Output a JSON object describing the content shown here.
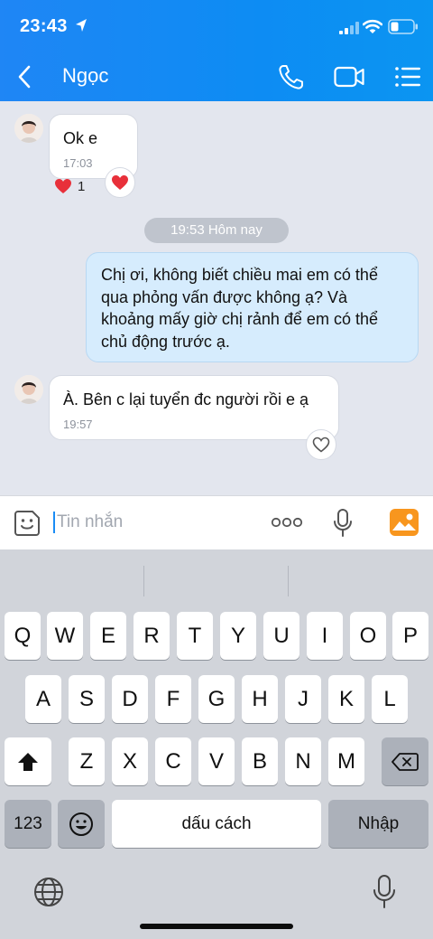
{
  "status_bar": {
    "time": "23:43"
  },
  "header": {
    "contact_name": "Ngọc"
  },
  "messages": {
    "m1": {
      "text": "Ok e",
      "time": "17:03",
      "reaction_count": "1"
    },
    "date_separator": "19:53 Hôm nay",
    "m2": {
      "lines": [
        "Chị ơi, không biết chiều mai em có thể",
        "qua phỏng vấn được không ạ? Và",
        "khoảng mấy giờ chị rảnh để em có thể",
        "chủ động trước ạ."
      ]
    },
    "m3": {
      "text": "À. Bên c lại tuyển đc người rồi e ạ",
      "time": "19:57"
    }
  },
  "input": {
    "placeholder": "Tin nhắn"
  },
  "keyboard": {
    "row1": [
      "Q",
      "W",
      "E",
      "R",
      "T",
      "Y",
      "U",
      "I",
      "O",
      "P"
    ],
    "row2": [
      "A",
      "S",
      "D",
      "F",
      "G",
      "H",
      "J",
      "K",
      "L"
    ],
    "row3": [
      "Z",
      "X",
      "C",
      "V",
      "B",
      "N",
      "M"
    ],
    "numbers_key": "123",
    "space_key": "dấu cách",
    "return_key": "Nhập"
  },
  "colors": {
    "header_blue": "#1f86f5",
    "outgoing_bubble": "#d6ecfd",
    "chat_bg": "#e3e6ee",
    "heart_red": "#e8303a"
  },
  "icons": [
    "location-arrow-icon",
    "signal-icon",
    "wifi-icon",
    "battery-icon",
    "back-chevron-icon",
    "phone-icon",
    "video-camera-icon",
    "menu-list-icon",
    "heart-icon",
    "sticker-face-icon",
    "more-dots-icon",
    "microphone-icon",
    "gallery-icon",
    "shift-icon",
    "backspace-icon",
    "emoji-icon",
    "globe-icon"
  ]
}
